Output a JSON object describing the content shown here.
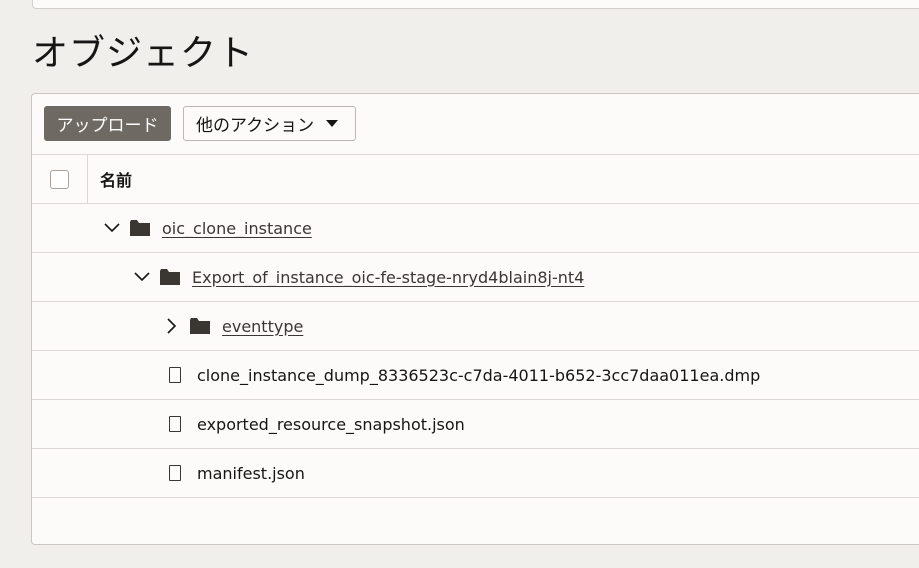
{
  "page": {
    "title": "オブジェクト"
  },
  "toolbar": {
    "upload_label": "アップロード",
    "more_actions_label": "他のアクション"
  },
  "table": {
    "columns": {
      "name": "名前"
    },
    "rows": [
      {
        "type": "folder",
        "expanded": true,
        "name": "oic_clone_instance"
      },
      {
        "type": "folder",
        "expanded": true,
        "name": "Export_of_instance_oic-fe-stage-nryd4blain8j-nt4"
      },
      {
        "type": "folder",
        "expanded": false,
        "name": "eventtype"
      },
      {
        "type": "file",
        "name": "clone_instance_dump_8336523c-c7da-4011-b652-3cc7daa011ea.dmp"
      },
      {
        "type": "file",
        "name": "exported_resource_snapshot.json"
      },
      {
        "type": "file",
        "name": "manifest.json"
      }
    ]
  },
  "colors": {
    "background": "#f1efec",
    "panel": "#fcfbfa",
    "primary_button": "#6f6964",
    "border": "#dcd8d3",
    "link": "#3a3632"
  }
}
